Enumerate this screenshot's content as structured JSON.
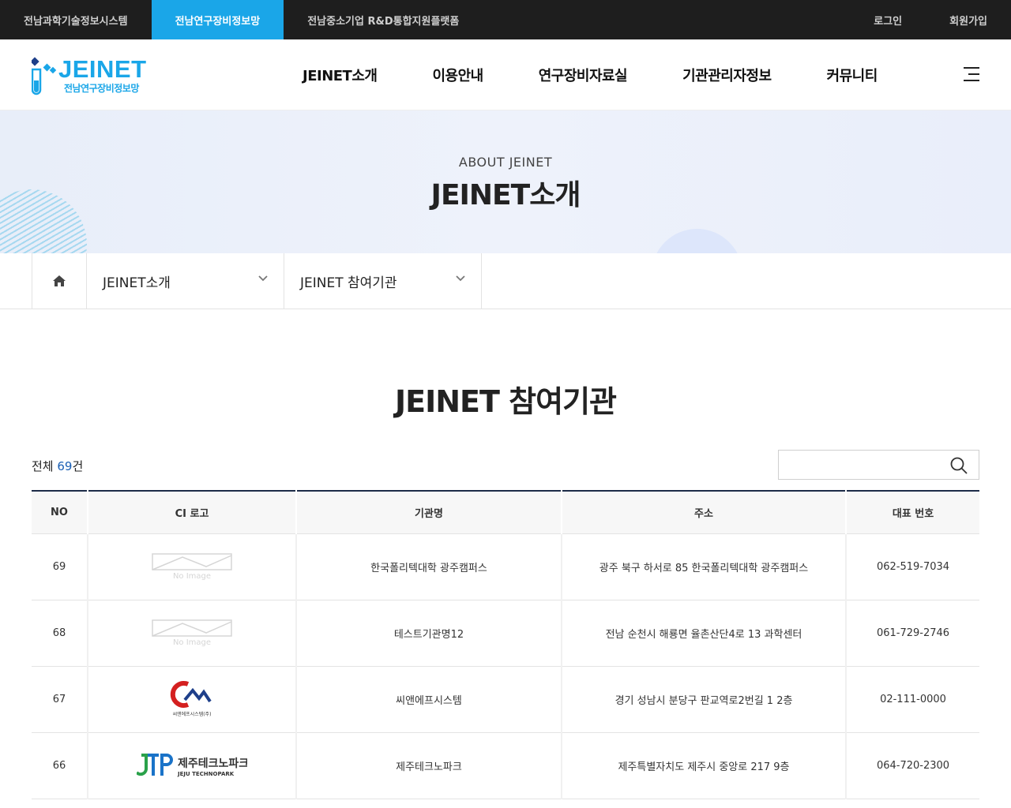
{
  "topbar": {
    "sites": [
      {
        "label": "전남과학기술정보시스템",
        "active": false
      },
      {
        "label": "전남연구장비정보망",
        "active": true
      },
      {
        "label": "전남중소기업 R&D통합지원플랫폼",
        "active": false
      }
    ],
    "login": "로그인",
    "signup": "회원가입"
  },
  "logo": {
    "word": "JEINET",
    "sub": "전남연구장비정보망"
  },
  "gnb": [
    "JEINET소개",
    "이용안내",
    "연구장비자료실",
    "기관관리자정보",
    "커뮤니티"
  ],
  "hero": {
    "eyebrow": "ABOUT JEINET",
    "title": "JEINET소개"
  },
  "location": {
    "depth1": "JEINET소개",
    "depth2": "JEINET 참여기관"
  },
  "page_title": "JEINET 참여기관",
  "total": {
    "prefix": "전체 ",
    "count": "69",
    "suffix": "건"
  },
  "search": {
    "placeholder": ""
  },
  "table": {
    "headers": [
      "NO",
      "CI 로고",
      "기관명",
      "주소",
      "대표 번호"
    ],
    "rows": [
      {
        "no": "69",
        "logo": "no-image",
        "name": "한국폴리텍대학 광주캠퍼스",
        "address": "광주 북구 하서로 85 한국폴리텍대학 광주캠퍼스",
        "phone": "062-519-7034"
      },
      {
        "no": "68",
        "logo": "no-image",
        "name": "테스트기관명12",
        "address": "전남 순천시 해룡면 율촌산단4로 13 과학센터",
        "phone": "061-729-2746"
      },
      {
        "no": "67",
        "logo": "cnf",
        "logo_text": "씨앤에프시스템(주)",
        "name": "씨앤에프시스템",
        "address": "경기 성남시 분당구 판교역로2번길 1 2층",
        "phone": "02-111-0000"
      },
      {
        "no": "66",
        "logo": "jtp",
        "logo_text": "제주테크노파크",
        "logo_text_en": "JEJU TECHNOPARK",
        "name": "제주테크노파크",
        "address": "제주특별자치도 제주시 중앙로 217 9층",
        "phone": "064-720-2300"
      }
    ]
  },
  "noimage_text": "No Image",
  "colors": {
    "accent": "#1aa6e8",
    "dark": "#1e1e1e",
    "count": "#1a5fb4",
    "table_top": "#1c2b48"
  }
}
